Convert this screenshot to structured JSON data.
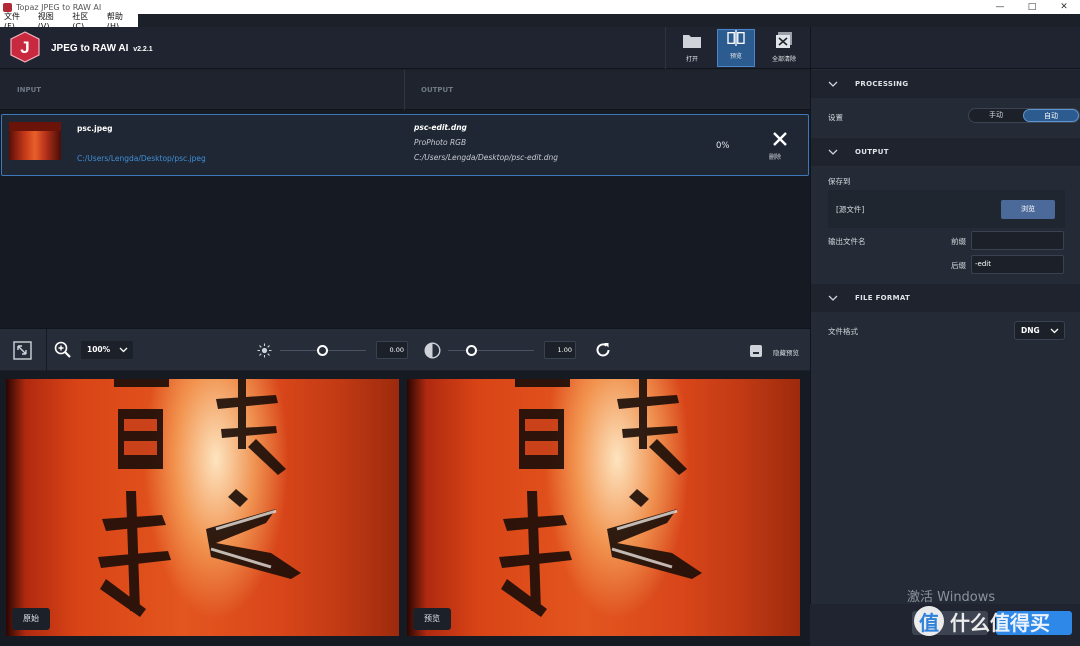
{
  "window": {
    "title": "Topaz JPEG to RAW AI",
    "controls": [
      "—",
      "□",
      "✕"
    ]
  },
  "menu": [
    "文件(F)",
    "视图(V)",
    "社区(C)",
    "帮助(H)"
  ],
  "header": {
    "logo_letter": "J",
    "app_name": "JPEG to RAW AI",
    "version": "v2.2.1",
    "tools": {
      "open_label": "打开",
      "preview_label": "预览",
      "clear_all_label": "全部清除"
    }
  },
  "list": {
    "input_header": "INPUT",
    "output_header": "OUTPUT",
    "item": {
      "input_name": "psc.jpeg",
      "input_path": "C:/Users/Lengda/Desktop/psc.jpeg",
      "output_name": "psc-edit.dng",
      "output_profile": "ProPhoto RGB",
      "output_path": "C:/Users/Lengda/Desktop/psc-edit.dng",
      "progress": "0%",
      "delete_label": "删除"
    }
  },
  "preview_toolbar": {
    "zoom": "100%",
    "exposure_value": "0.00",
    "contrast_value": "1.00",
    "hide_preview_label": "隐藏预览"
  },
  "viewer": {
    "original_label": "原始",
    "preview_label": "预览"
  },
  "right_panel": {
    "processing": {
      "title": "PROCESSING",
      "setting_label": "设置",
      "manual_label": "手动",
      "auto_label": "自动"
    },
    "output": {
      "title": "OUTPUT",
      "save_to_label": "保存到",
      "source_folder_label": "[源文件]",
      "browse_label": "浏览",
      "filename_label": "输出文件名",
      "prefix_label": "前缀",
      "prefix_value": "",
      "suffix_label": "后缀",
      "suffix_value": "-edit"
    },
    "file_format": {
      "title": "FILE FORMAT",
      "format_label": "文件格式",
      "format_value": "DNG"
    }
  },
  "overlay": {
    "activate_windows": "激活 Windows",
    "watermark": "什么值得买"
  },
  "colors": {
    "accent": "#2e88e8",
    "selection_border": "#3e78b8",
    "path_link": "#3e8fd8"
  }
}
